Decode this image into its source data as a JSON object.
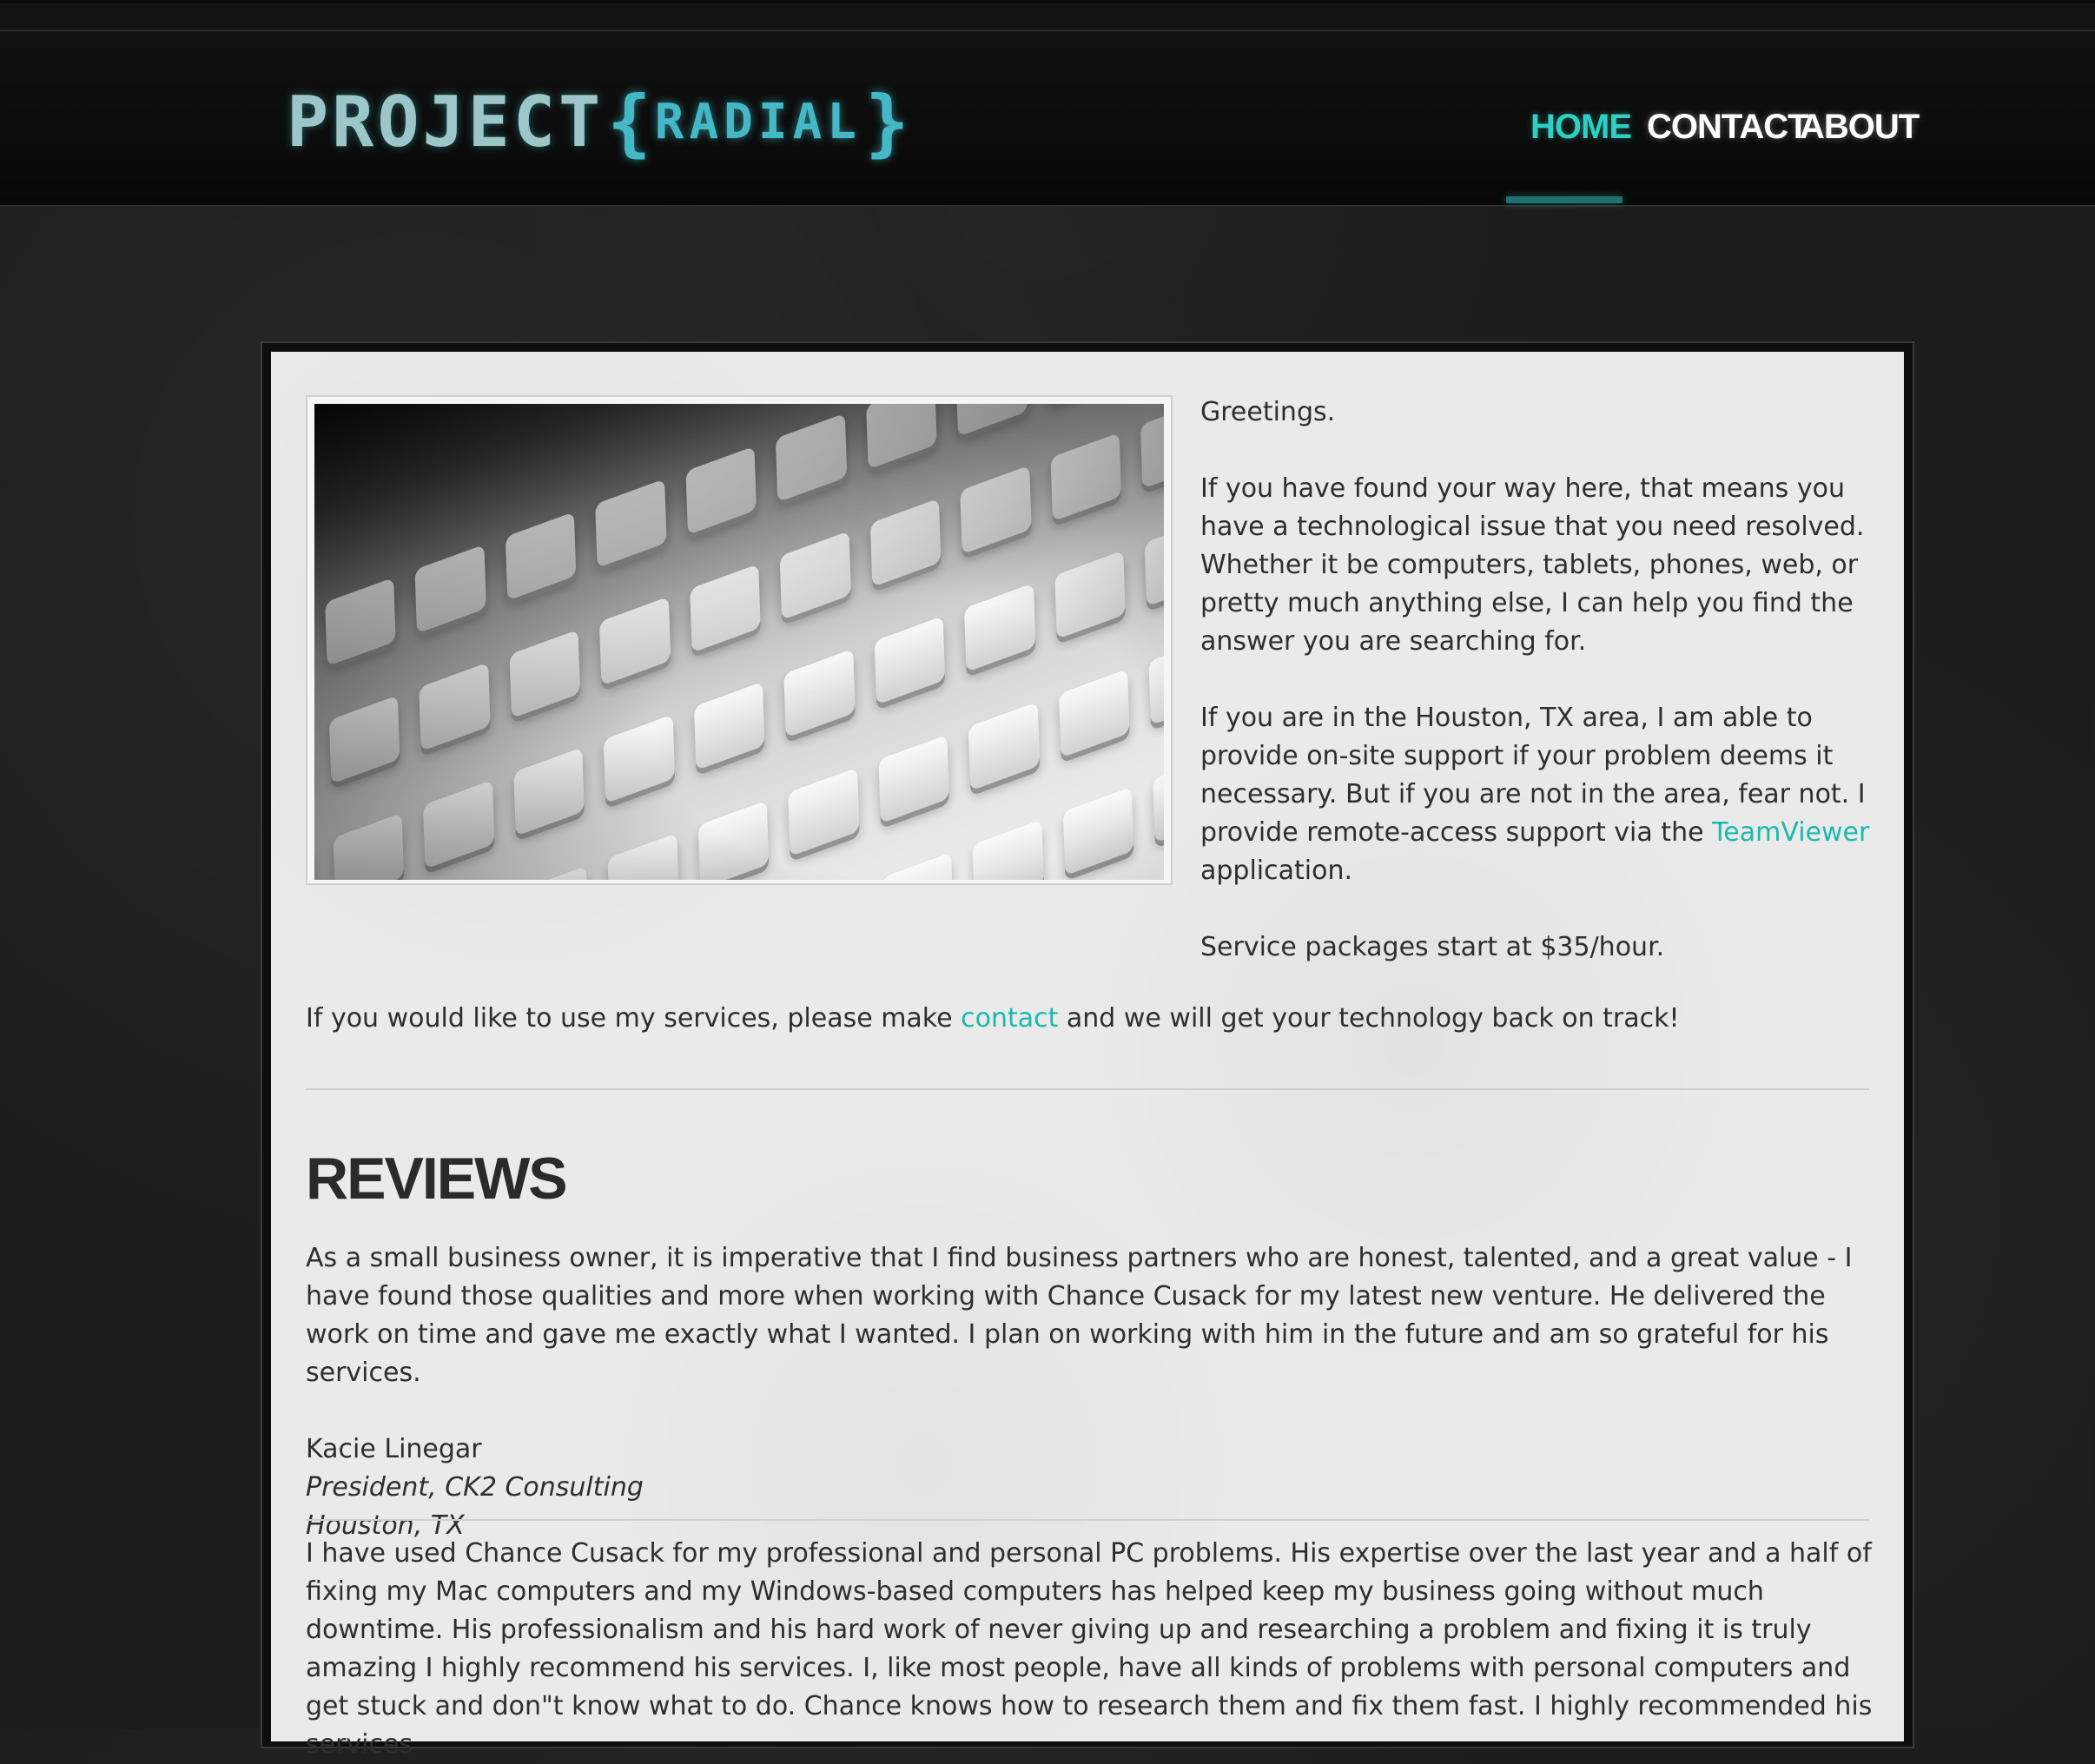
{
  "brand": {
    "logo_main": "PROJECT",
    "logo_brace_open": "{",
    "logo_sub": "RADIAL",
    "logo_brace_close": "}"
  },
  "nav": {
    "home": "HOME",
    "contact": "CONTACT",
    "about": "ABOUT",
    "active": "home"
  },
  "intro": {
    "greeting": "Greetings.",
    "p1": "If you have found your way here, that means you have a technological issue that you need resolved. Whether it be computers, tablets, phones, web, or pretty much anything else, I can help you find the answer you are searching for.",
    "p2_before": "If you are in the Houston, TX area, I am able to provide on-site support if your problem deems it necessary. But if you are not in the area, fear not. I provide remote-access support via the ",
    "p2_link": "TeamViewer",
    "p2_after": " application.",
    "p3": "Service packages start at $35/hour."
  },
  "cta": {
    "before": "If you would like to use my services, please make ",
    "link": "contact",
    "after": " and we will get your technology back on track!"
  },
  "reviews": {
    "title": "REVIEWS",
    "items": [
      {
        "quote": "As a small business owner, it is imperative that I find business partners who are honest, talented, and a great value - I have found those qualities and more when working with Chance Cusack for my latest new venture. He delivered the work on time and gave me exactly what I wanted. I plan on working with him in the future and am so grateful for his services.",
        "author": "Kacie Linegar",
        "role": "President, CK2 Consulting",
        "location": "Houston, TX"
      },
      {
        "quote": "I have used Chance Cusack for my professional and personal PC problems. His expertise over the last year and a half of fixing my Mac computers and my Windows-based computers has helped keep my business going without much downtime. His professionalism and his hard work of never giving up and researching a problem and fixing it is truly amazing I highly recommend his services. I, like most people, have all kinds of problems with personal computers and get stuck and don\"t know what to do. Chance knows how to research them and fix them fast. I highly recommended his services"
      }
    ]
  },
  "colors": {
    "accent": "#2ed0c4",
    "link": "#1bb9ad",
    "panel_bg": "#eaeaea",
    "page_bg": "#1c1c1c",
    "text": "#2e2e2e"
  },
  "icons": {
    "hero": "keyboard-photo"
  }
}
